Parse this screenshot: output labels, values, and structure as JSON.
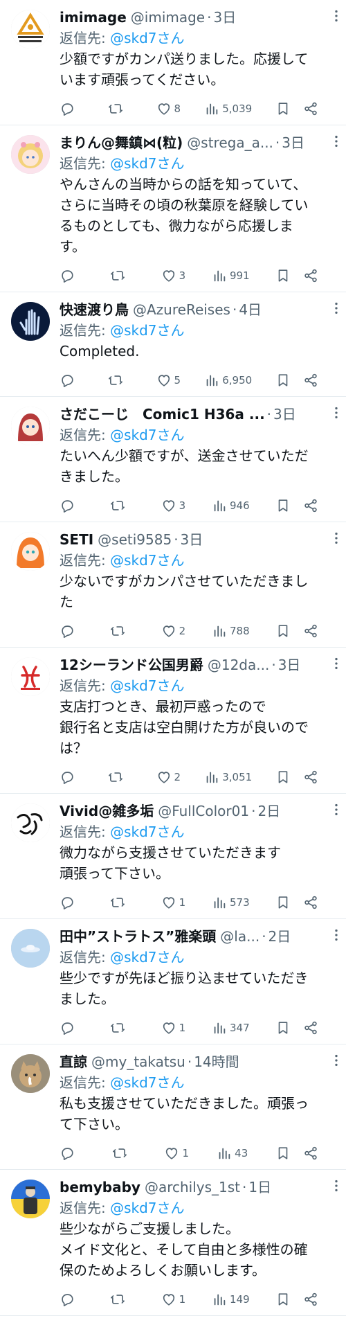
{
  "reply_prefix": "返信先:",
  "tweets": [
    {
      "name": "imimage",
      "handle": "@imimage",
      "time": "3日",
      "reply_to": "@skd7さん",
      "text": "少額ですがカンパ送りました。応援しています頑張ってください。",
      "likes": "8",
      "views": "5,039",
      "avatar": "logo-triangle"
    },
    {
      "name": "まりん@舞鎮⋈(粒)",
      "handle": "@strega_a...",
      "time": "3日",
      "reply_to": "@skd7さん",
      "text": "やんさんの当時からの話を知っていて、さらに当時その頃の秋葉原を経験しているものとしても、微力ながら応援します。",
      "likes": "3",
      "views": "991",
      "avatar": "girl-blonde"
    },
    {
      "name": "快速渡り鳥",
      "handle": "@AzureReises",
      "time": "4日",
      "reply_to": "@skd7さん",
      "text": "Completed.",
      "likes": "5",
      "views": "6,950",
      "avatar": "xray-hand"
    },
    {
      "name": "さだこーじ　Comic1 H36a ...",
      "handle": "",
      "time": "3日",
      "reply_to": "@skd7さん",
      "text": "たいへん少額ですが、送金させていただきました。",
      "likes": "3",
      "views": "946",
      "avatar": "girl-redhair"
    },
    {
      "name": "SETI",
      "handle": "@seti9585",
      "time": "3日",
      "reply_to": "@skd7さん",
      "text": "少ないですがカンパさせていただきました",
      "likes": "2",
      "views": "788",
      "avatar": "girl-orange"
    },
    {
      "name": "12シーランド公国男爵",
      "handle": "@12da...",
      "time": "3日",
      "reply_to": "@skd7さん",
      "text": "支店打つとき、最初戸惑ったので\n銀行名と支店は空白開けた方が良いのでは？",
      "likes": "2",
      "views": "3,051",
      "avatar": "red-logo"
    },
    {
      "name": "Vivid@雑多垢",
      "handle": "@FullColor01",
      "time": "2日",
      "reply_to": "@skd7さん",
      "text": "微力ながら支援させていただきます\n頑張って下さい。",
      "likes": "1",
      "views": "573",
      "avatar": "calligraphy"
    },
    {
      "name": "田中”ストラトス”雅楽頭",
      "handle": "@la...",
      "time": "2日",
      "reply_to": "@skd7さん",
      "text": "些少ですが先ほど振り込ませていただきました。",
      "likes": "1",
      "views": "347",
      "avatar": "ufo-sky"
    },
    {
      "name": "直諒",
      "handle": "@my_takatsu",
      "time": "14時間",
      "reply_to": "@skd7さん",
      "text": "私も支援させていただきました。頑張って下さい。",
      "likes": "1",
      "views": "43",
      "avatar": "cat"
    },
    {
      "name": "bemybaby",
      "handle": "@archilys_1st",
      "time": "1日",
      "reply_to": "@skd7さん",
      "text": "些少ながらご支援しました。\nメイド文化と、そして自由と多様性の確保のためよろしくお願いします。",
      "likes": "1",
      "views": "149",
      "avatar": "figure-ukraine"
    }
  ],
  "colors": {
    "accent": "#1d9bf0",
    "secondary_text": "#536471",
    "divider": "#e6ecf0"
  }
}
